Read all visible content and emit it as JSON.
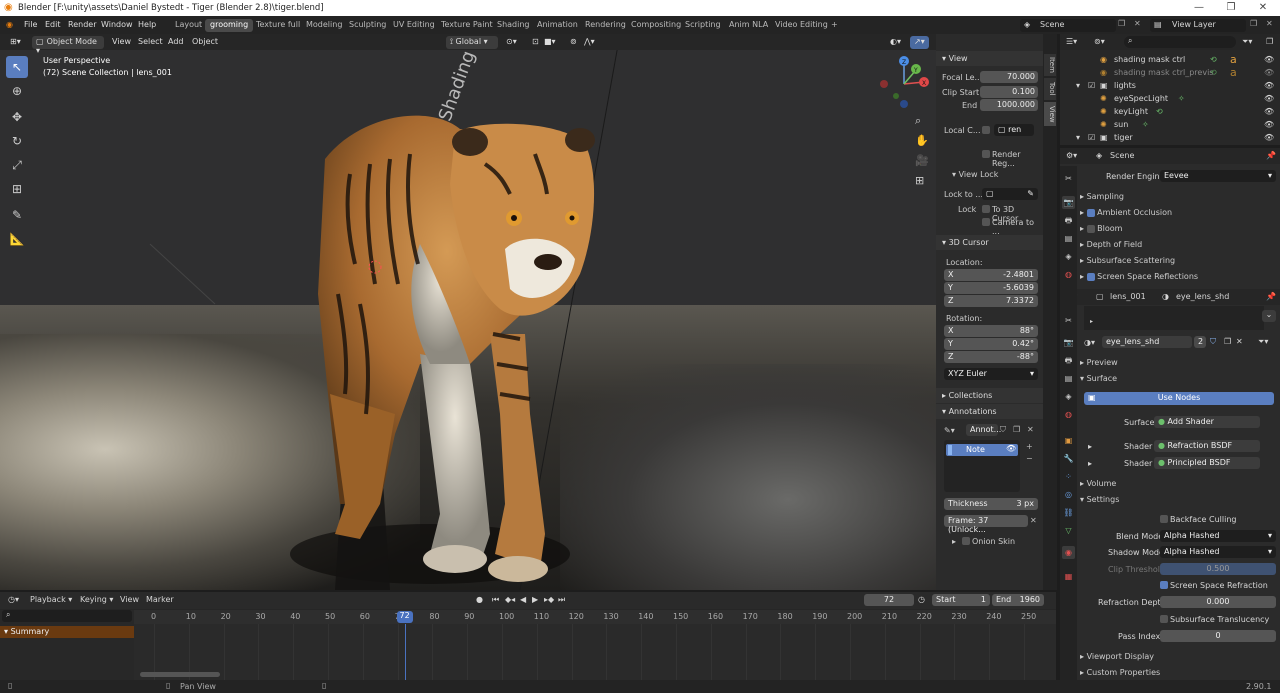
{
  "titlebar": {
    "title": "Blender [F:\\unity\\assets\\Daniel Bystedt - Tiger (Blender 2.8)\\tiger.blend]",
    "minimize": "—",
    "maximize": "❐",
    "close": "✕"
  },
  "menu": {
    "items": [
      "File",
      "Edit",
      "Render",
      "Window",
      "Help"
    ]
  },
  "workspaces": [
    "Layout",
    "grooming",
    "Texture full",
    "Modeling",
    "Sculpting",
    "UV Editing",
    "Texture Paint",
    "Shading",
    "Animation",
    "Rendering",
    "Compositing",
    "Scripting",
    "Anim NLA",
    "Video Editing"
  ],
  "workspace_active": "grooming",
  "topright": {
    "scene": "Scene",
    "view_layer": "View Layer"
  },
  "viewport": {
    "mode": "Object Mode",
    "menus": [
      "View",
      "Select",
      "Add",
      "Object"
    ],
    "orientation": "Global",
    "overlay_line1": "User Perspective",
    "overlay_line2": "(72) Scene Collection | lens_001",
    "gizmo": {
      "x": "X",
      "y": "Y",
      "z": "Z"
    }
  },
  "sidebar": {
    "tabs": [
      "Item",
      "Tool",
      "View"
    ],
    "view_header": "View",
    "focal_label": "Focal Le...",
    "focal_value": "70.000",
    "clip_start_label": "Clip Start",
    "clip_start_value": "0.100",
    "end_label": "End",
    "end_value": "1000.000",
    "local_camera_label": "Local C...",
    "local_camera_value": "ren",
    "render_region": "Render Reg...",
    "view_lock_header": "View Lock",
    "lock_to_label": "Lock to ...",
    "lock_label": "Lock",
    "to_3d_cursor": "To 3D Cursor",
    "camera_to": "Camera to ...",
    "cursor_header": "3D Cursor",
    "location_label": "Location:",
    "loc": [
      {
        "axis": "X",
        "value": "-2.4801"
      },
      {
        "axis": "Y",
        "value": "-5.6039"
      },
      {
        "axis": "Z",
        "value": "7.3372"
      }
    ],
    "rotation_label": "Rotation:",
    "rot": [
      {
        "axis": "X",
        "value": "88°"
      },
      {
        "axis": "Y",
        "value": "0.42°"
      },
      {
        "axis": "Z",
        "value": "-88°"
      }
    ],
    "rotation_mode": "XYZ Euler",
    "collections_header": "Collections",
    "annotations_header": "Annotations",
    "annot_name": "Annot...",
    "note_label": "Note",
    "thickness_label": "Thickness",
    "thickness_value": "3 px",
    "frame_label": "Frame: 37 (Unlock...",
    "onion_skin": "Onion Skin"
  },
  "outliner": {
    "rows": [
      {
        "name": "shading mask ctrl",
        "indent": 1
      },
      {
        "name": "shading mask ctrl_previs",
        "indent": 1
      },
      {
        "name": "lights",
        "indent": 0
      },
      {
        "name": "eyeSpecLight",
        "indent": 1
      },
      {
        "name": "keyLight",
        "indent": 1
      },
      {
        "name": "sun",
        "indent": 1
      },
      {
        "name": "tiger",
        "indent": 0
      }
    ]
  },
  "render_props": {
    "scene": "Scene",
    "engine_label": "Render Engine",
    "engine_value": "Eevee",
    "sections": [
      {
        "label": "Sampling",
        "checkbox": false,
        "checked": false
      },
      {
        "label": "Ambient Occlusion",
        "checkbox": true,
        "checked": true
      },
      {
        "label": "Bloom",
        "checkbox": true,
        "checked": false
      },
      {
        "label": "Depth of Field",
        "checkbox": false,
        "checked": false
      },
      {
        "label": "Subsurface Scattering",
        "checkbox": false,
        "checked": false
      },
      {
        "label": "Screen Space Reflections",
        "checkbox": true,
        "checked": true
      }
    ]
  },
  "material_props": {
    "object": "lens_001",
    "material": "eye_lens_shd",
    "slot_material": "eye_lens_shd",
    "users": "2",
    "preview": "Preview",
    "surface": "Surface",
    "use_nodes": "Use Nodes",
    "surface_label": "Surface",
    "surface_value": "Add Shader",
    "shader_label": "Shader",
    "shader1": "Refraction BSDF",
    "shader2": "Principled BSDF",
    "volume": "Volume",
    "settings": "Settings",
    "backface": "Backface Culling",
    "blend_label": "Blend Mode",
    "blend_value": "Alpha Hashed",
    "shadow_label": "Shadow Mode",
    "shadow_value": "Alpha Hashed",
    "clip_label": "Clip Threshold",
    "clip_value": "0.500",
    "ssr": "Screen Space Refraction",
    "refr_depth_label": "Refraction Depth",
    "refr_depth_value": "0.000",
    "sss_translucency": "Subsurface Translucency",
    "pass_index_label": "Pass Index",
    "pass_index_value": "0",
    "viewport_display": "Viewport Display",
    "custom_props": "Custom Properties"
  },
  "timeline": {
    "menus": [
      "Playback",
      "Keying",
      "View",
      "Marker"
    ],
    "current_frame": "72",
    "start_label": "Start",
    "start_value": "1",
    "end_label": "End",
    "end_value": "1960",
    "summary": "Summary",
    "ticks": [
      "0",
      "10",
      "20",
      "30",
      "40",
      "50",
      "60",
      "70",
      "80",
      "90",
      "100",
      "110",
      "120",
      "130",
      "140",
      "150",
      "160",
      "170",
      "180",
      "190",
      "200",
      "210",
      "220",
      "230",
      "240",
      "250"
    ],
    "playhead": "72"
  },
  "status": {
    "pan_view": "Pan View",
    "version": "2.90.1"
  }
}
